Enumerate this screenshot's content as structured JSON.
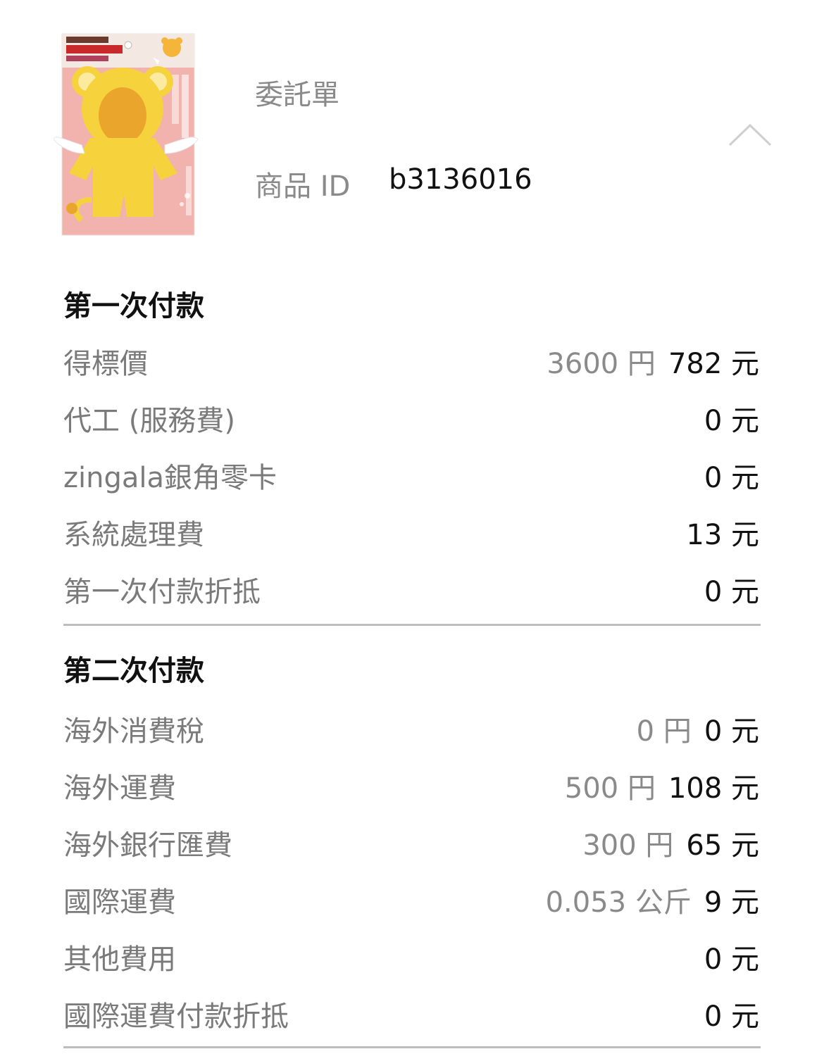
{
  "order": {
    "title_label": "委託單",
    "title_value": "",
    "product_id_label": "商品 ID",
    "product_id_value": "b3136016",
    "product_image": "plush-doll-costume-package"
  },
  "first_payment": {
    "title": "第一次付款",
    "rows": [
      {
        "label": "得標價",
        "orig": "3600 円",
        "twd": "782 元"
      },
      {
        "label": "代工 (服務費)",
        "orig": "",
        "twd": "0 元"
      },
      {
        "label": "zingala銀角零卡",
        "orig": "",
        "twd": "0 元"
      },
      {
        "label": "系統處理費",
        "orig": "",
        "twd": "13 元"
      },
      {
        "label": "第一次付款折抵",
        "orig": "",
        "twd": "0 元"
      }
    ]
  },
  "second_payment": {
    "title": "第二次付款",
    "rows": [
      {
        "label": "海外消費稅",
        "orig": "0 円",
        "twd": "0 元"
      },
      {
        "label": "海外運費",
        "orig": "500 円",
        "twd": "108 元"
      },
      {
        "label": "海外銀行匯費",
        "orig": "300 円",
        "twd": "65 元"
      },
      {
        "label": "國際運費",
        "orig": "0.053 公斤",
        "twd": "9 元"
      },
      {
        "label": "其他費用",
        "orig": "",
        "twd": "0 元"
      },
      {
        "label": "國際運費付款折抵",
        "orig": "",
        "twd": "0 元"
      }
    ]
  },
  "colors": {
    "label_gray": "#7a7a7a",
    "value_black": "#111111",
    "divider": "#bdbdbd",
    "chevron": "#cfcfcf"
  },
  "icons": {
    "collapse": "chevron-up-icon"
  }
}
